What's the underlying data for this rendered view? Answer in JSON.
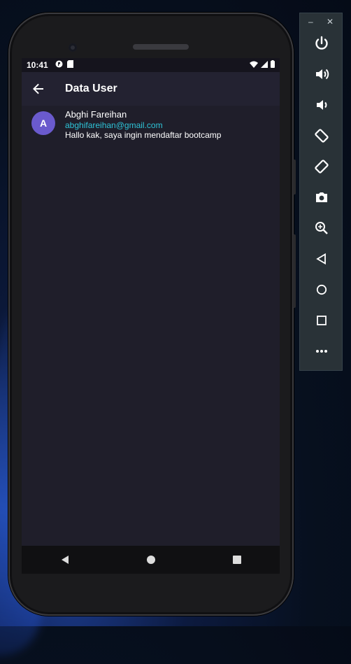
{
  "status": {
    "time": "10:41"
  },
  "appbar": {
    "title": "Data User"
  },
  "users": [
    {
      "initial": "A",
      "name": "Abghi Fareihan",
      "email": "abghifareihan@gmail.com",
      "message": "Hallo kak, saya ingin mendaftar bootcamp"
    }
  ],
  "emulator": {
    "minimize": "–",
    "close": "✕"
  },
  "colors": {
    "avatar": "#6a5acd",
    "email": "#2ec4d8",
    "screen_bg": "#1f1e2a",
    "appbar_bg": "#232231"
  }
}
